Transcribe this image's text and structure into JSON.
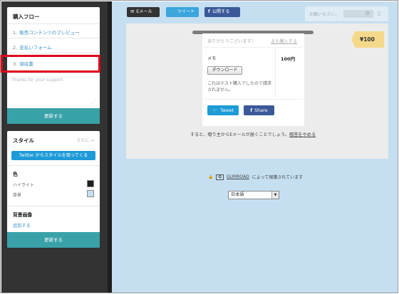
{
  "sidebar": {
    "flow_panel": {
      "title": "購入フロー",
      "items": [
        {
          "num": "1.",
          "label": "販売コンテンツのプレビュー"
        },
        {
          "num": "2.",
          "label": "支払いフォーム"
        },
        {
          "num": "3.",
          "label": "領収書"
        }
      ],
      "textarea_placeholder": "Thanks for your support.",
      "update_button": "更新する"
    },
    "style_panel": {
      "title": "スタイル",
      "more_link": "さらに →",
      "twitter_button": "Twitter からスタイルを取ってくる",
      "color_heading": "色",
      "highlight_label": "ハイライト",
      "background_label": "背景",
      "highlight_color": "#1e1e1e",
      "background_color": "#c5dff1",
      "bg_image_heading": "背景画像",
      "add_link": "追加する",
      "update_button": "更新する"
    }
  },
  "share_bar": {
    "email": "Eメール",
    "tweet": "ツイート",
    "facebook": "公開する"
  },
  "top_right": {
    "greeting": "お願いなさい、"
  },
  "receipt": {
    "thanks": "ありがとうございます！",
    "buy_again": "また購入する",
    "memo_label": "メモ",
    "download_button": "ダウンロード",
    "test_note": "これはテスト購入でしたので請求されません。",
    "price": "100円",
    "tweet_button": "Tweet",
    "share_button": "Share"
  },
  "price_tag": "¥100",
  "note": {
    "text": "すると、贈り主からEメールが届くことでしょう。",
    "link": "贈答をやめる"
  },
  "footer": {
    "brand": "GUMROAD",
    "secure_text": "によって保護されています",
    "language": "日本語"
  },
  "colors": {
    "accent_teal": "#39a2a9",
    "twitter_blue": "#1e9bd7",
    "facebook_blue": "#3b5998",
    "selection_red": "#e0001a"
  }
}
